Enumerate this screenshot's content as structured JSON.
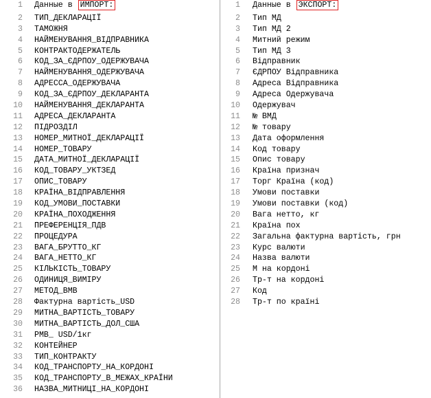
{
  "import": {
    "prefix": "Данные в",
    "highlight": "ИМПОРТ:",
    "lines": [
      "ТИП_ДЕКЛАРАЦІЇ",
      "ТАМОЖНЯ",
      "НАЙМЕНУВАННЯ_ВІДПРАВНИКА",
      "КОНТРАКТОДЕРЖАТЕЛЬ",
      "КОД_ЗА_ЄДРПОУ_ОДЕРЖУВАЧА",
      "НАЙМЕНУВАННЯ_ОДЕРЖУВАЧА",
      "АДРЕССА_ОДЕРЖУВАЧА",
      "КОД_ЗА_ЄДРПОУ_ДЕКЛАРАНТА",
      "НАЙМЕНУВАННЯ_ДЕКЛАРАНТА",
      "АДРЕСА_ДЕКЛАРАНТА",
      "ПІДРОЗДІЛ",
      "НОМЕР_МИТНОЇ_ДЕКЛАРАЦІЇ",
      "НОМЕР_ТОВАРУ",
      "ДАТА_МИТНОЇ_ДЕКЛАРАЦІЇ",
      "КОД_ТОВАРУ_УКТЗЕД",
      "ОПИС_ТОВАРУ",
      "КРАЇНА_ВІДПРАВЛЕННЯ",
      "КОД_УМОВИ_ПОСТАВКИ",
      "КРАЇНА_ПОХОДЖЕННЯ",
      "ПРЕФЕРЕНЦІЯ_ПДВ",
      "ПРОЦЕДУРА",
      "ВАГА_БРУТТО_КГ",
      "ВАГА_НЕТТО_КГ",
      "КІЛЬКІСТЬ_ТОВАРУ",
      "ОДИНИЦЯ_ВИМІРУ",
      "МЕТОД_ВМВ",
      "Фактурна вартість_USD",
      "МИТНА_ВАРТІСТЬ_ТОВАРУ",
      "МИТНА_ВАРТІСТЬ_ДОЛ_США",
      "РМВ_ USD/1кг",
      "КОНТЕЙНЕР",
      "ТИП_КОНТРАКТУ",
      "КОД_ТРАНСПОРТУ_НА_КОРДОНІ",
      "КОД_ТРАНСПОРТУ_В_МЕЖАХ_КРАЇНИ",
      "НАЗВА_МИТНИЦІ_НА_КОРДОНІ"
    ]
  },
  "export": {
    "prefix": "Данные в",
    "highlight": "ЭКСПОРТ:",
    "lines": [
      "Тип МД",
      "Тип МД 2",
      "Митний режим",
      "Тип МД 3",
      "Відправник",
      "ЄДРПОУ Відправника",
      "Адреса Відправника",
      "Адреса Одержувача",
      "Одержувач",
      "№ ВМД",
      "№ товару",
      "Дата оформлення",
      "Код товару",
      "Опис товару",
      "Країна признач",
      "Торг Країна (код)",
      "Умови поставки",
      "Умови поставки (код)",
      "Вага нетто, кг",
      "Країна пох",
      "Загальна фактурна вартість, грн",
      "Курс валюти",
      "Назва валюти",
      "М на кордоні",
      "Тр-т на кордоні",
      "Код",
      "Тр-т по країні"
    ]
  },
  "colors": {
    "line_number": "#8c8c8c",
    "highlight_border": "#e02020",
    "divider": "#a8a8a8"
  }
}
